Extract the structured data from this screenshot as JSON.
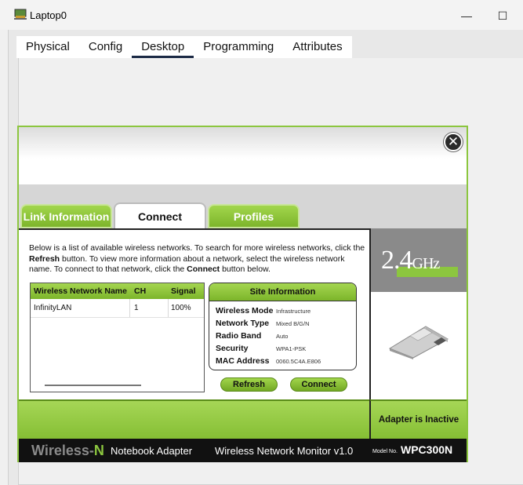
{
  "window": {
    "title": "Laptop0",
    "minimize": "—",
    "maximize": "☐"
  },
  "tabs": [
    {
      "label": "Physical"
    },
    {
      "label": "Config"
    },
    {
      "label": "Desktop",
      "active": true
    },
    {
      "label": "Programming"
    },
    {
      "label": "Attributes"
    }
  ],
  "monitor": {
    "close": "✕",
    "tabs": {
      "link": "Link Information",
      "connect": "Connect",
      "profiles": "Profiles"
    },
    "description": {
      "p1": "Below is a list of available wireless networks. To search for more wireless networks, click the ",
      "b1": "Refresh",
      "p2": " button. To view more information about a network, select the wireless network name. To connect to that network, click the ",
      "b2": "Connect",
      "p3": " button below."
    },
    "network_list": {
      "headers": {
        "name": "Wireless Network Name",
        "ch": "CH",
        "signal": "Signal"
      },
      "rows": [
        {
          "name": "InfinityLAN",
          "ch": "1",
          "signal": "100%"
        }
      ]
    },
    "site_info": {
      "title": "Site Information",
      "mode_label": "Wireless Mode",
      "mode": "Infrastructure",
      "type_label": "Network Type",
      "type": "Mixed B/G/N",
      "band_label": "Radio Band",
      "band": "Auto",
      "security_label": "Security",
      "security": "WPA1-PSK",
      "mac_label": "MAC Address",
      "mac": "0060.5C4A.E806"
    },
    "buttons": {
      "refresh": "Refresh",
      "connect": "Connect"
    },
    "ghz": {
      "num": "2.4",
      "unit": "GHz"
    },
    "adapter_status": "Adapter is Inactive",
    "footer": {
      "brand_a": "Wireless-",
      "brand_b": "N",
      "adapter": "Notebook Adapter",
      "monitor": "Wireless Network Monitor  v1.0",
      "model_label": "Model No.",
      "model": "WPC300N"
    }
  }
}
